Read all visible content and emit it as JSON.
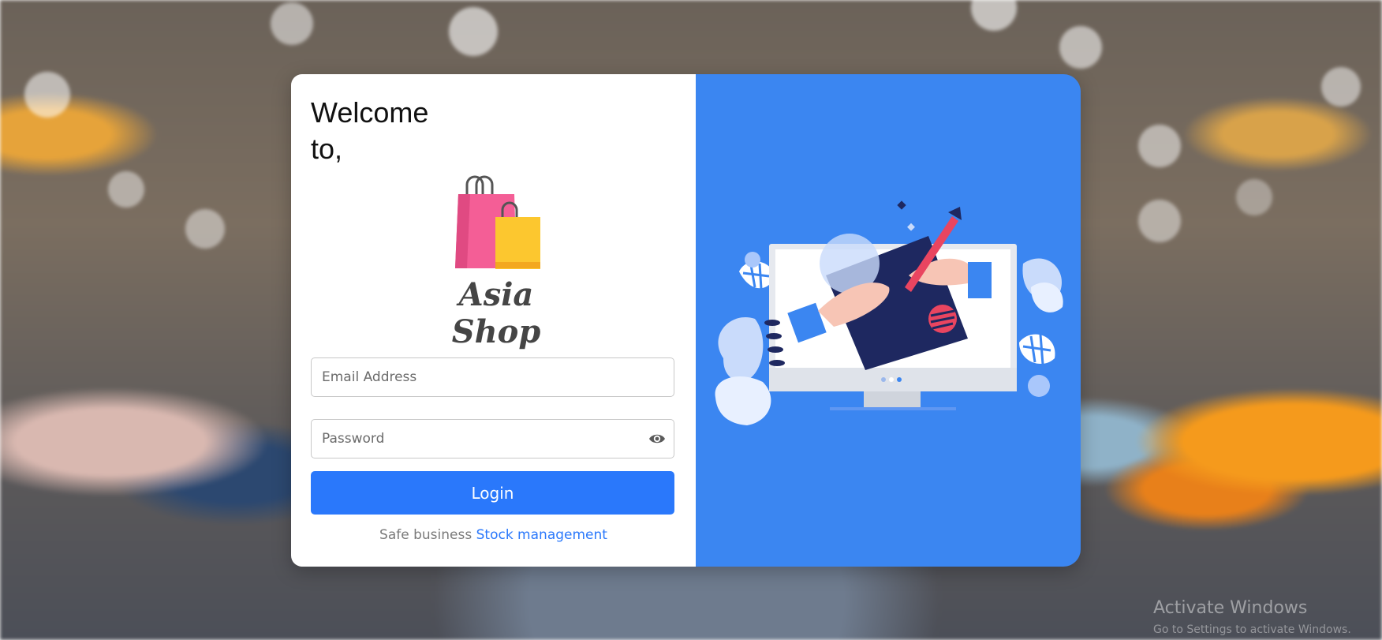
{
  "welcome": {
    "line1": "Welcome",
    "line2": "to,"
  },
  "brand": {
    "name": "Asia Shop",
    "logo_icon": "shopping-bags-icon"
  },
  "form": {
    "email_placeholder": "Email Address",
    "password_placeholder": "Password",
    "toggle_icon": "eye-icon",
    "login_label": "Login"
  },
  "footer": {
    "text": "Safe business",
    "link": "Stock management"
  },
  "illustration": {
    "icon": "computer-drawing-illustration"
  },
  "os_watermark": {
    "title": "Activate Windows",
    "subtitle": "Go to Settings to activate Windows."
  },
  "colors": {
    "accent": "#2a78fb",
    "panel": "#3b86f1",
    "bag_pink": "#f45e96",
    "bag_yellow": "#fcc72f"
  }
}
